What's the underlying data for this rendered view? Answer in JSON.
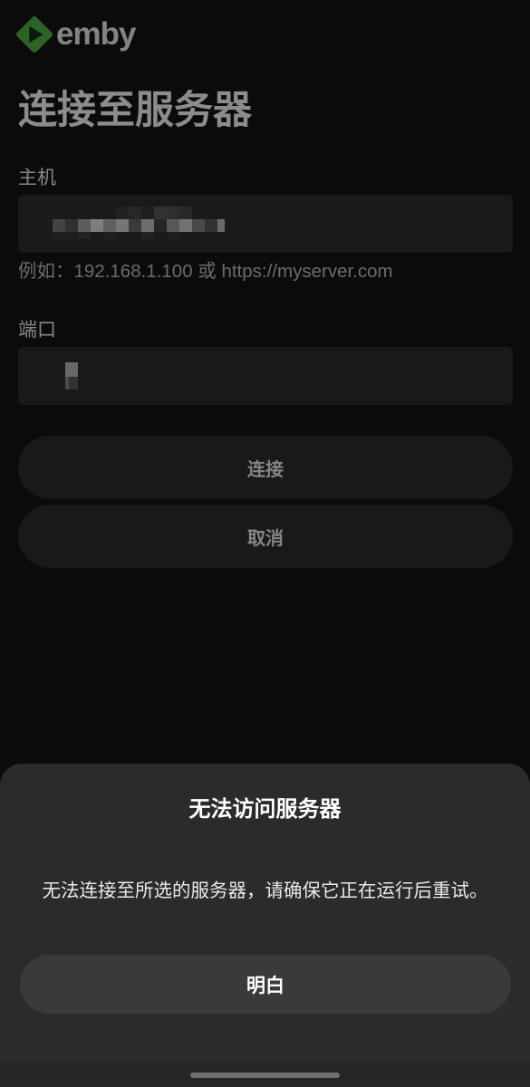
{
  "app": {
    "brand": "emby",
    "logo_icon": "emby-logo-icon"
  },
  "page": {
    "title": "连接至服务器"
  },
  "form": {
    "host": {
      "label": "主机",
      "hint": "例如：192.168.1.100 或 https://myserver.com"
    },
    "port": {
      "label": "端口"
    },
    "connect_label": "连接",
    "cancel_label": "取消"
  },
  "dialog": {
    "title": "无法访问服务器",
    "message": "无法连接至所选的服务器，请确保它正在运行后重试。",
    "confirm_label": "明白"
  },
  "colors": {
    "brand_green": "#52B54B",
    "sheet_background": "#2B2B2D",
    "sheet_button": "#3A3A3C"
  }
}
